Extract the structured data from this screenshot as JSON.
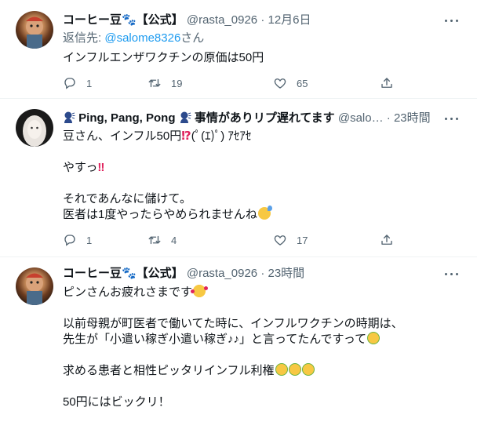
{
  "tweets": [
    {
      "name": "コーヒー豆🐾【公式】",
      "handle": "@rasta_0926",
      "time": "12月6日",
      "reply_prefix": "返信先: ",
      "reply_handle": "@salome8326",
      "reply_suffix": "さん",
      "line1": "インフルエンザワクチンの原価は50円",
      "replies": "1",
      "retweets": "19",
      "likes": "65"
    },
    {
      "name": "Ping, Pang, Pong",
      "name_suffix": "事情がありリプ遅れてます",
      "handle": "@salo…",
      "time": "23時間",
      "line1": "豆さん、インフル50円",
      "line1_face": "(ﾟ(ｴ)ﾟ) ｱｾｱｾ",
      "line2": "やすっ",
      "line3": "それであんなに儲けて。",
      "line4": "医者は1度やったらやめられませんね",
      "replies": "1",
      "retweets": "4",
      "likes": "17"
    },
    {
      "name": "コーヒー豆🐾【公式】",
      "handle": "@rasta_0926",
      "time": "23時間",
      "line1": "ピンさんお疲れさまです",
      "line2": "以前母親が町医者で働いてた時に、インフルワクチンの時期は、",
      "line3": "先生が「小遣い稼ぎ小遣い稼ぎ♪♪」と言ってたんですって",
      "line4": "求める患者と相性ピッタリインフル利権",
      "line5": "50円にはビックリ！"
    }
  ],
  "dot": "·",
  "icons": [
    "reply-icon",
    "retweet-icon",
    "like-icon",
    "share-icon",
    "more-icon"
  ],
  "colors": {
    "link": "#1d9bf0",
    "muted": "#536471",
    "text": "#0f1419"
  }
}
